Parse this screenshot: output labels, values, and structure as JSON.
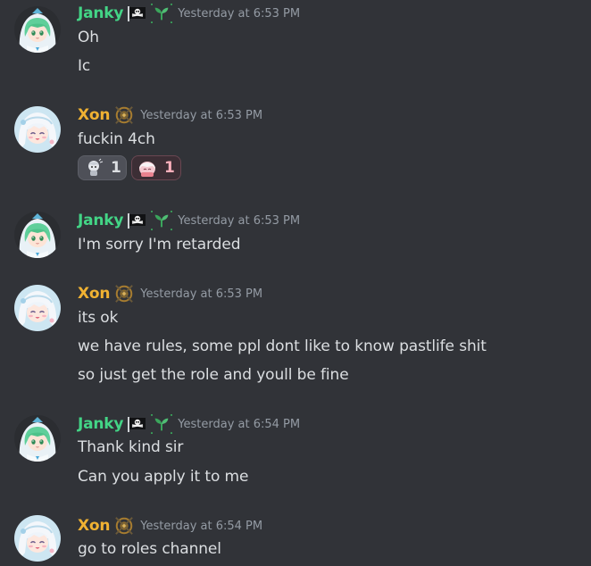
{
  "colors": {
    "background": "#313338",
    "janky_name": "#43d586",
    "xon_name": "#f0b232",
    "timestamp": "#949ba4",
    "message_text": "#dbdee1"
  },
  "messages": [
    {
      "author": "Janky",
      "avatar_icon": "anime-girl-green-hair-avatar",
      "badges": [
        "pirate-flag-icon",
        "sprout-icon"
      ],
      "timestamp": "Yesterday at 6:53 PM",
      "lines": [
        "Oh",
        "Ic"
      ]
    },
    {
      "author": "Xon",
      "avatar_icon": "anime-girl-white-hair-avatar",
      "badges": [
        "crossed-circle-icon"
      ],
      "timestamp": "Yesterday at 6:53 PM",
      "lines": [
        "fuckin 4ch"
      ],
      "reactions": [
        {
          "emoji": "chibi-grey-emoji",
          "count": "1"
        },
        {
          "emoji": "chibi-pink-emoji",
          "count": "1"
        }
      ]
    },
    {
      "author": "Janky",
      "avatar_icon": "anime-girl-green-hair-avatar",
      "badges": [
        "pirate-flag-icon",
        "sprout-icon"
      ],
      "timestamp": "Yesterday at 6:53 PM",
      "lines": [
        "I'm sorry I'm retarded"
      ]
    },
    {
      "author": "Xon",
      "avatar_icon": "anime-girl-white-hair-avatar",
      "badges": [
        "crossed-circle-icon"
      ],
      "timestamp": "Yesterday at 6:53 PM",
      "lines": [
        "its ok",
        "we have rules, some ppl dont like to know pastlife shit",
        "so just get the role and youll be fine"
      ]
    },
    {
      "author": "Janky",
      "avatar_icon": "anime-girl-green-hair-avatar",
      "badges": [
        "pirate-flag-icon",
        "sprout-icon"
      ],
      "timestamp": "Yesterday at 6:54 PM",
      "lines": [
        "Thank kind sir",
        "Can you apply it to me"
      ]
    },
    {
      "author": "Xon",
      "avatar_icon": "anime-girl-white-hair-avatar",
      "badges": [
        "crossed-circle-icon"
      ],
      "timestamp": "Yesterday at 6:54 PM",
      "lines": [
        "go to roles channel"
      ]
    }
  ]
}
